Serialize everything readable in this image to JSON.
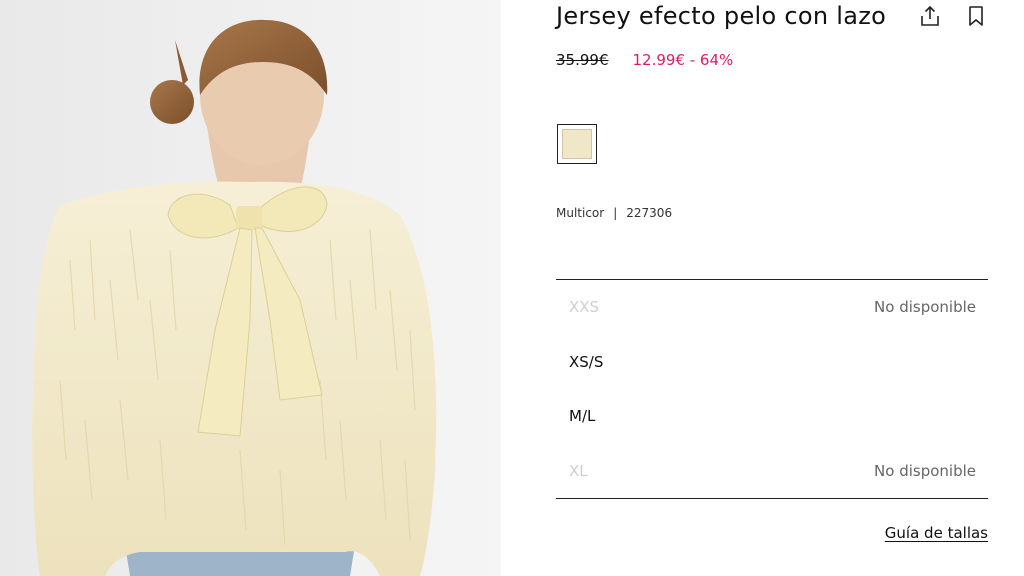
{
  "product": {
    "title": "Jersey efecto pelo con lazo",
    "old_price": "35.99€",
    "sale_price": "12.99€ - 64%",
    "color_name": "Multicor",
    "separator": "|",
    "reference": "227306",
    "swatch_color": "#f0e6c8",
    "sale_color": "#e0196b"
  },
  "sizes": [
    {
      "label": "XXS",
      "status": "No disponible",
      "available": false
    },
    {
      "label": "XS/S",
      "status": "",
      "available": true
    },
    {
      "label": "M/L",
      "status": "",
      "available": true
    },
    {
      "label": "XL",
      "status": "No disponible",
      "available": false
    }
  ],
  "links": {
    "size_guide": "Guía de tallas"
  },
  "icons": {
    "share": "share-icon",
    "save": "bookmark-icon"
  }
}
